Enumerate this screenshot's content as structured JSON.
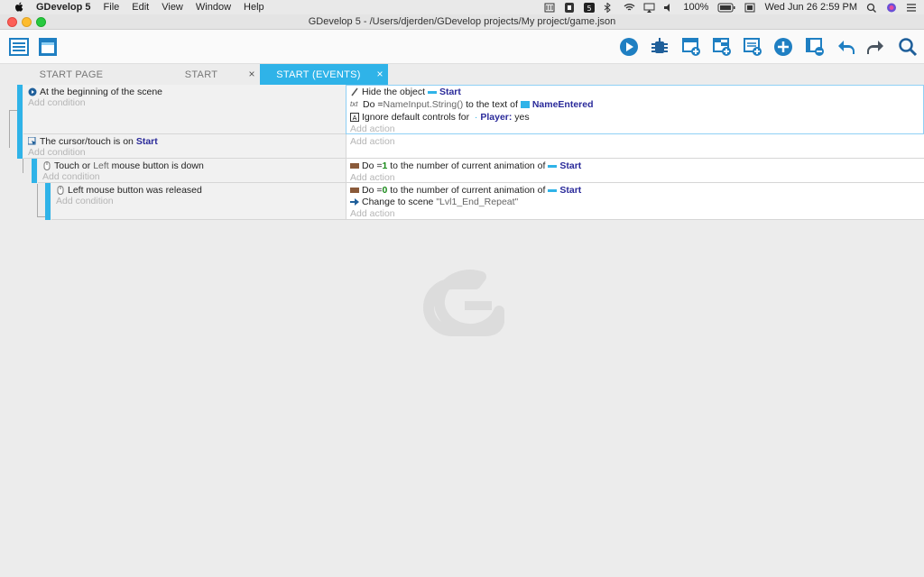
{
  "menubar": {
    "app_name": "GDevelop 5",
    "menus": [
      "File",
      "Edit",
      "View",
      "Window",
      "Help"
    ],
    "battery": "100%",
    "datetime": "Wed Jun 26  2:59 PM"
  },
  "window": {
    "title": "GDevelop 5 - /Users/djerden/GDevelop projects/My project/game.json"
  },
  "tabs": [
    {
      "label": "START PAGE"
    },
    {
      "label": "START"
    },
    {
      "label": "START (EVENTS)"
    }
  ],
  "events": [
    {
      "condition": "At the beginning of the scene",
      "add_condition": "Add condition",
      "actions": [
        {
          "prefix": "Hide the object",
          "object": "Start"
        },
        {
          "prefix": "Do =",
          "expr": "NameInput.String()",
          "mid": "to the text of",
          "object": "NameEntered"
        },
        {
          "prefix": "Ignore default controls for",
          "object": "Player:",
          "suffix": "yes"
        }
      ],
      "add_action": "Add action"
    },
    {
      "condition_prefix": "The cursor/touch is on",
      "condition_object": "Start",
      "add_condition": "Add condition",
      "add_action": "Add action"
    },
    {
      "condition_a": "Touch or",
      "condition_b": "Left",
      "condition_c": "mouse button is down",
      "add_condition": "Add condition",
      "actions": [
        {
          "prefix": "Do =",
          "value": "1",
          "mid": "to the number of current animation of",
          "object": "Start"
        }
      ],
      "add_action": "Add action"
    },
    {
      "condition": "Left mouse button was released",
      "add_condition": "Add condition",
      "actions": [
        {
          "prefix": "Do =",
          "value": "0",
          "mid": "to the number of current animation of",
          "object": "Start"
        },
        {
          "prefix": "Change to scene",
          "value": "\"Lvl1_End_Repeat\""
        }
      ],
      "add_action": "Add action"
    }
  ],
  "colors": {
    "accent": "#2fb3e8",
    "object": "#2a2a9a",
    "number": "#1a8a1a"
  }
}
